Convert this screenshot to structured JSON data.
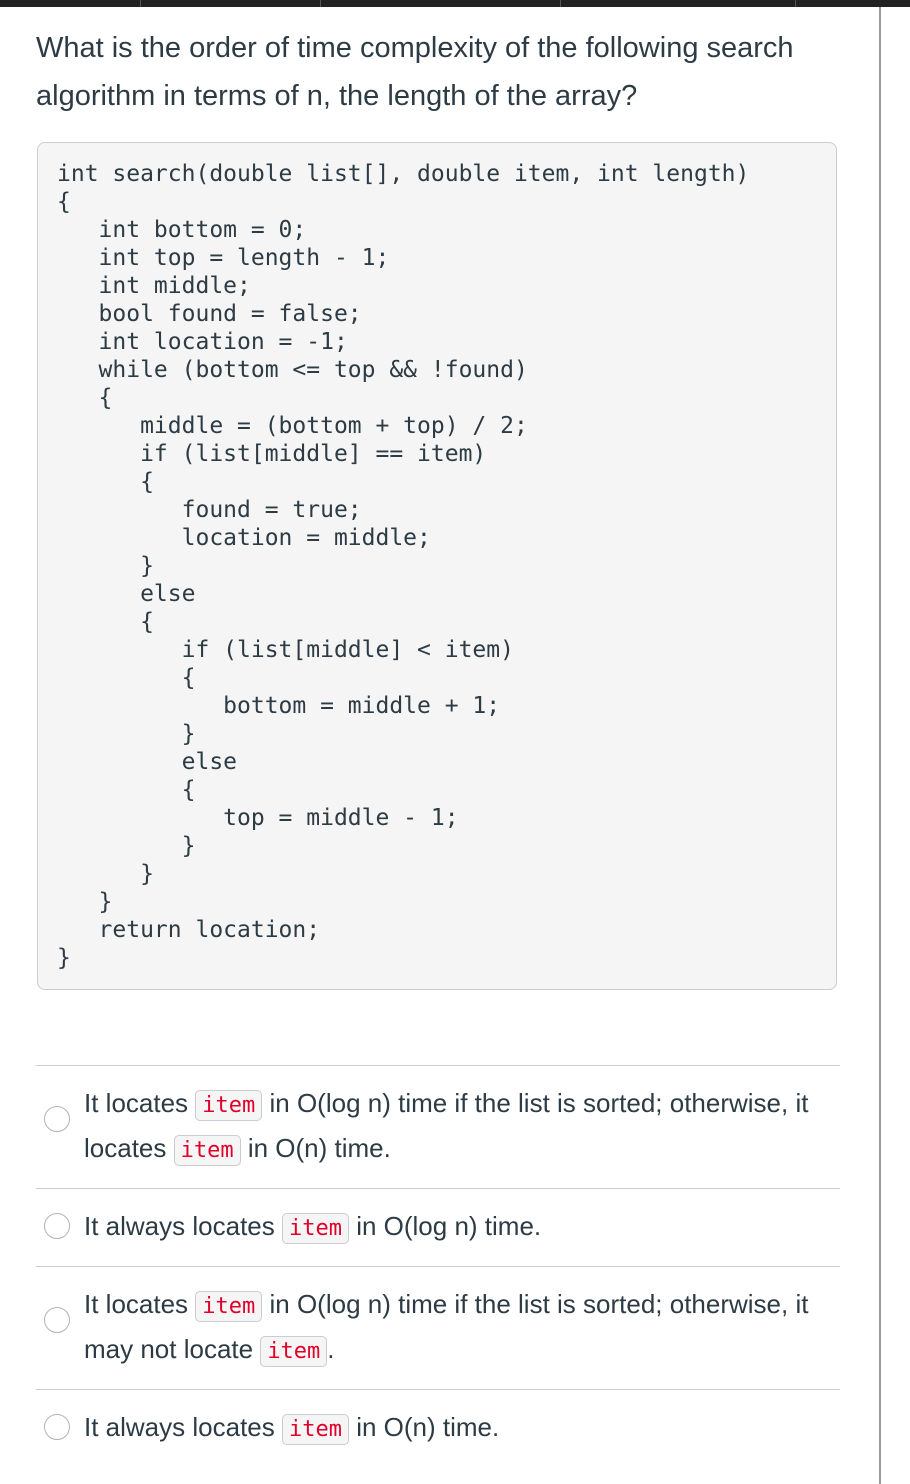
{
  "question": "What is the order of time complexity of the following search algorithm in terms of n, the length of the array?",
  "code": "int search(double list[], double item, int length)\n{\n   int bottom = 0;\n   int top = length - 1;\n   int middle;\n   bool found = false;\n   int location = -1;\n   while (bottom <= top && !found)\n   {\n      middle = (bottom + top) / 2;\n      if (list[middle] == item)\n      {\n         found = true;\n         location = middle;\n      }\n      else\n      {\n         if (list[middle] < item)\n         {\n            bottom = middle + 1;\n         }\n         else\n         {\n            top = middle - 1;\n         }\n      }\n   }\n   return location;\n}",
  "answers": [
    {
      "pre": "It locates ",
      "code1": "item",
      "mid": " in O(log n) time if the list is sorted; otherwise, it locates ",
      "code2": "item",
      "post": " in O(n) time."
    },
    {
      "pre": "It always locates ",
      "code1": "item",
      "mid": " in O(log n) time.",
      "code2": "",
      "post": ""
    },
    {
      "pre": "It locates ",
      "code1": "item",
      "mid": " in O(log n) time if the list is sorted; otherwise, it may not locate ",
      "code2": "item",
      "post": "."
    },
    {
      "pre": "It always locates ",
      "code1": "item",
      "mid": " in O(n) time.",
      "code2": "",
      "post": ""
    }
  ]
}
